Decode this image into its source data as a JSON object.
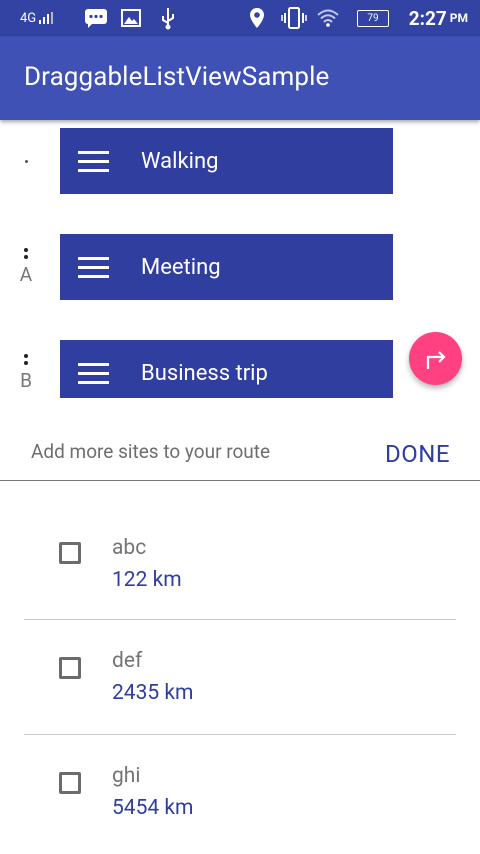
{
  "status_bar": {
    "network": "4G",
    "battery": "79",
    "time": "2:27",
    "ampm": "PM"
  },
  "app_bar": {
    "title": "DraggableListViewSample"
  },
  "route": [
    {
      "marker": "",
      "label": "Walking"
    },
    {
      "marker": "A",
      "label": "Meeting"
    },
    {
      "marker": "B",
      "label": "Business trip"
    }
  ],
  "add_more": {
    "text": "Add more sites to your route",
    "done": "DONE"
  },
  "sites": [
    {
      "name": "abc",
      "distance": "122 km"
    },
    {
      "name": "def",
      "distance": "2435 km"
    },
    {
      "name": "ghi",
      "distance": "5454 km"
    }
  ],
  "colors": {
    "status_bar": "#3343a3",
    "app_bar": "#3f51b5",
    "card": "#303f9f",
    "fab": "#ff4081"
  }
}
